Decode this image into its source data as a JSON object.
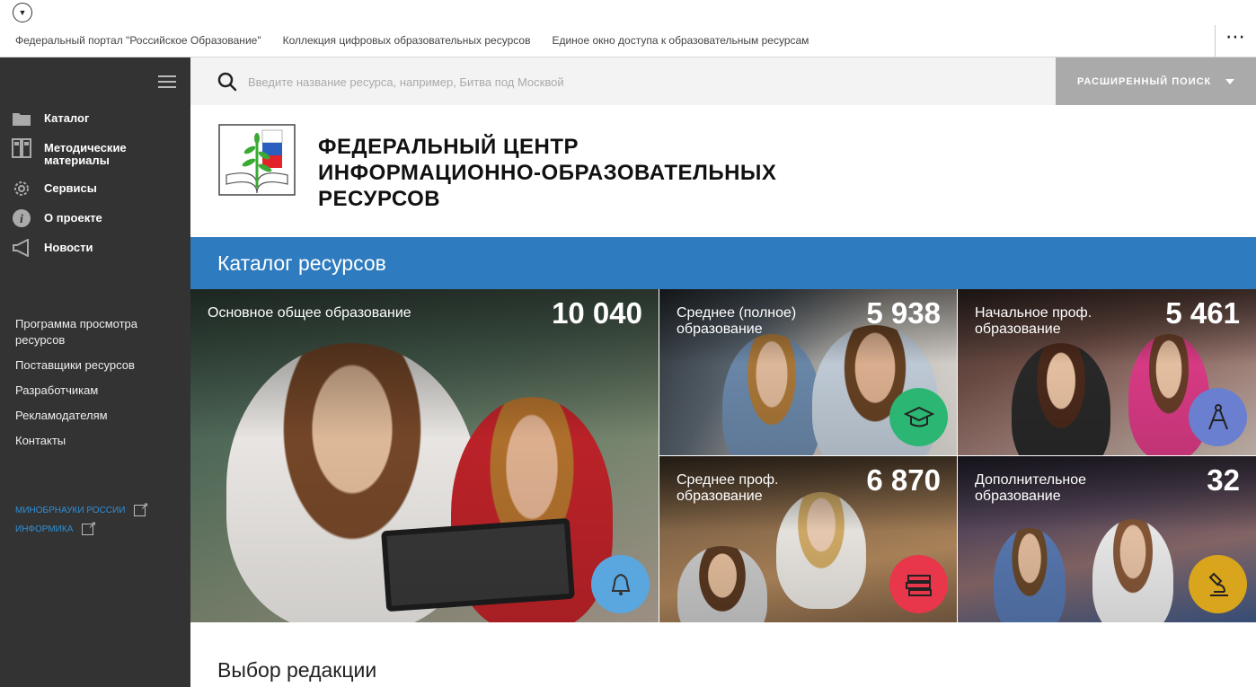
{
  "topbar": {
    "links": [
      "Федеральный портал \"Российское Образование\"",
      "Коллекция цифровых образовательных ресурсов",
      "Единое окно доступа к образовательным ресурсам"
    ],
    "more_label": "⋯",
    "toggle_icon": "chevron-down-circle-icon"
  },
  "sidebar": {
    "nav": [
      {
        "label": "Каталог",
        "icon": "folder-icon"
      },
      {
        "label": "Методические материалы",
        "icon": "binders-icon"
      },
      {
        "label": "Сервисы",
        "icon": "gear-icon"
      },
      {
        "label": "О проекте",
        "icon": "info-icon"
      },
      {
        "label": "Новости",
        "icon": "megaphone-icon"
      }
    ],
    "links": [
      "Программа просмотра ресурсов",
      "Поставщики ресурсов",
      "Разработчикам",
      "Рекламодателям",
      "Контакты"
    ],
    "external": [
      "МИНОБРНАУКИ РОССИИ",
      "ИНФОРМИКА"
    ]
  },
  "search": {
    "placeholder": "Введите название ресурса, например, Битва под Москвой",
    "advanced_label": "РАСШИРЕННЫЙ ПОИСК"
  },
  "header": {
    "title_lines": [
      "ФЕДЕРАЛЬНЫЙ ЦЕНТР",
      "ИНФОРМАЦИОННО-ОБРАЗОВАТЕЛЬНЫХ",
      "РЕСУРСОВ"
    ]
  },
  "catalog": {
    "title": "Каталог ресурсов",
    "tiles": [
      {
        "title": "Основное общее образование",
        "count": "10 040",
        "icon": "bell-icon",
        "badge_color": "#5aa7e0"
      },
      {
        "title": "Среднее (полное) образование",
        "count": "5 938",
        "icon": "graduation-cap-icon",
        "badge_color": "#2bb673"
      },
      {
        "title": "Начальное проф. образование",
        "count": "5 461",
        "icon": "compass-icon",
        "badge_color": "#6a7fd0"
      },
      {
        "title": "Среднее проф. образование",
        "count": "6 870",
        "icon": "books-icon",
        "badge_color": "#e8364a"
      },
      {
        "title": "Дополнительное образование",
        "count": "32",
        "icon": "microscope-icon",
        "badge_color": "#d9a51c"
      }
    ]
  },
  "editors_choice": "Выбор редакции"
}
